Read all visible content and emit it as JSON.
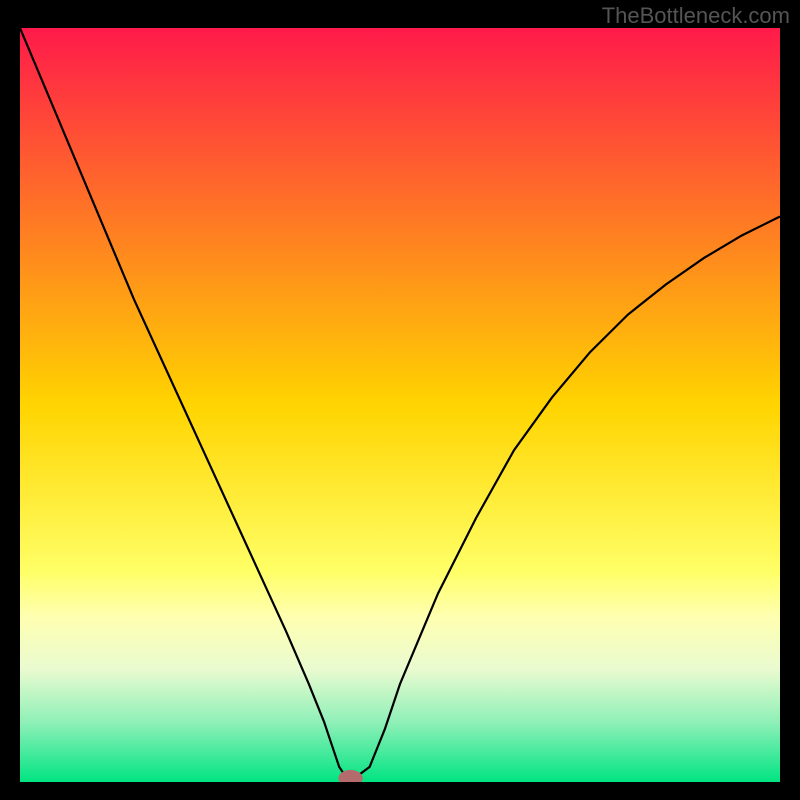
{
  "watermark": "TheBottleneck.com",
  "chart_data": {
    "type": "line",
    "title": "",
    "xlabel": "",
    "ylabel": "",
    "xlim": [
      0,
      100
    ],
    "ylim": [
      0,
      100
    ],
    "background_gradient": {
      "stops": [
        {
          "offset": 0.0,
          "color": "#ff1a4a"
        },
        {
          "offset": 0.5,
          "color": "#ffd400"
        },
        {
          "offset": 0.72,
          "color": "#ffff66"
        },
        {
          "offset": 0.78,
          "color": "#ffffb0"
        },
        {
          "offset": 0.85,
          "color": "#eafbd0"
        },
        {
          "offset": 0.92,
          "color": "#90f0b8"
        },
        {
          "offset": 1.0,
          "color": "#00e482"
        }
      ]
    },
    "series": [
      {
        "name": "bottleneck-curve",
        "stroke": "#000000",
        "stroke_width": 2.2,
        "x": [
          0,
          5,
          10,
          15,
          20,
          25,
          30,
          35,
          38,
          40,
          41,
          42,
          43,
          44,
          46,
          48,
          50,
          55,
          60,
          65,
          70,
          75,
          80,
          85,
          90,
          95,
          100
        ],
        "y": [
          100,
          88,
          76,
          64,
          53,
          42,
          31,
          20,
          13,
          8,
          5,
          2,
          0.5,
          0.5,
          2,
          7,
          13,
          25,
          35,
          44,
          51,
          57,
          62,
          66,
          69.5,
          72.5,
          75
        ]
      }
    ],
    "marker": {
      "name": "selected-point",
      "x": 43.5,
      "y": 0.5,
      "rx": 1.6,
      "ry": 1.1,
      "fill": "#b36b6b"
    }
  }
}
